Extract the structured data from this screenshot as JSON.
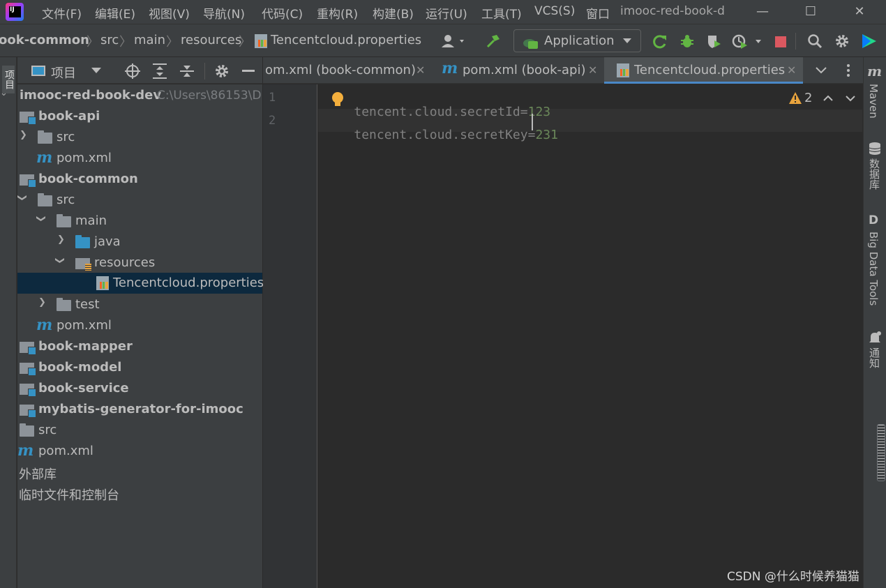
{
  "menubar": {
    "items": [
      "文件(F)",
      "编辑(E)",
      "视图(V)",
      "导航(N)",
      "代码(C)",
      "重构(R)",
      "构建(B)",
      "运行(U)",
      "工具(T)",
      "VCS(S)",
      "窗口"
    ],
    "window_title": "imooc-red-book-d",
    "minimize": "—",
    "maximize": "☐",
    "close": "✕"
  },
  "breadcrumb": [
    "ook-common",
    "src",
    "main",
    "resources",
    "Tencentcloud.properties"
  ],
  "toolbar": {
    "run_config": "Application"
  },
  "left_strip": {
    "label": "项目"
  },
  "project_panel": {
    "title": "项目",
    "root": {
      "name": "imooc-red-book-dev",
      "path": "C:\\Users\\86153\\D"
    },
    "rows": [
      {
        "label": "book-api"
      },
      {
        "label": "src"
      },
      {
        "label": "pom.xml"
      },
      {
        "label": "book-common"
      },
      {
        "label": "src"
      },
      {
        "label": "main"
      },
      {
        "label": "java"
      },
      {
        "label": "resources"
      },
      {
        "label": "Tencentcloud.properties"
      },
      {
        "label": "test"
      },
      {
        "label": "pom.xml"
      },
      {
        "label": "book-mapper"
      },
      {
        "label": "book-model"
      },
      {
        "label": "book-service"
      },
      {
        "label": "mybatis-generator-for-imooc"
      },
      {
        "label": "src"
      },
      {
        "label": "pom.xml"
      },
      {
        "label": "外部库"
      },
      {
        "label": "临时文件和控制台"
      }
    ]
  },
  "tabs": [
    {
      "label": "om.xml (book-common)",
      "close": "✕"
    },
    {
      "label": "pom.xml (book-api)",
      "close": "✕"
    },
    {
      "label": "Tencentcloud.properties",
      "close": "✕"
    }
  ],
  "editor": {
    "line_numbers": [
      "1",
      "2"
    ],
    "lines": [
      {
        "key": "tencent.cloud.secretId=",
        "value": "123"
      },
      {
        "key": "tencent.cloud.secretKey=",
        "value": "231"
      }
    ],
    "warning_count": "2"
  },
  "right_strip": {
    "maven": "Maven",
    "database": "数据库",
    "bigdata": "Big Data Tools",
    "notifications": "通知"
  },
  "watermark": "CSDN @什么时候养猫猫",
  "colors": {
    "accent": "#4a88c7",
    "value_green": "#6a8759",
    "warning_yellow": "#e8a33d",
    "selection": "#0d293e"
  }
}
